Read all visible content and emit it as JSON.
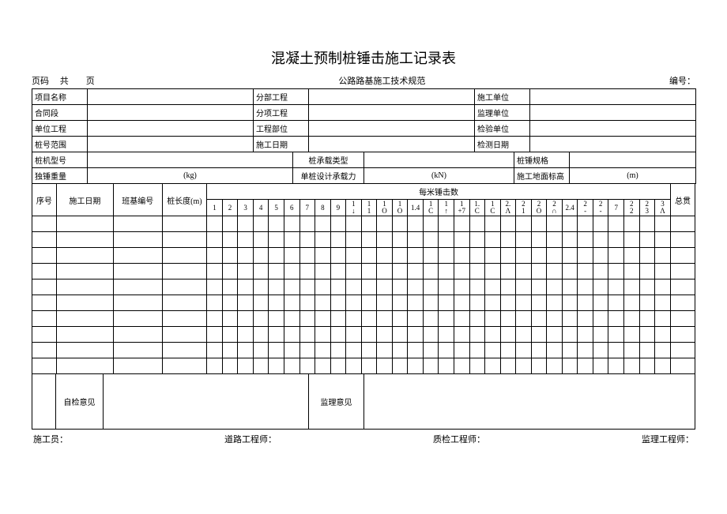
{
  "title": "混凝土预制桩锤击施工记录表",
  "top": {
    "page_label": "页码     共        页",
    "spec": "公路路基施工技术规范",
    "code_label": "编号："
  },
  "hdr": {
    "project_name": "项目名称",
    "sub_project": "分部工程",
    "construct_unit": "施工单位",
    "contract": "合同段",
    "item_project": "分项工程",
    "super_unit": "监理单位",
    "unit_project": "单位工程",
    "part": "工程部位",
    "inspect_unit": "检验单位",
    "pile_range": "桩号范围",
    "construct_date": "施工日期",
    "test_date": "检测日期",
    "pile_machine": "桩机型号",
    "pile_type": "桩承载类型",
    "pile_spec": "桩锤规格",
    "hammer_weight": "独锤重量",
    "hammer_unit": "(kg)",
    "design_cap": "单桩设计承载力",
    "cap_unit": "(kN)",
    "ground_elev": "施工地面标高",
    "elev_unit": "(m)"
  },
  "cols": {
    "seq": "序号",
    "date": "施工日期",
    "shift": "班基编号",
    "len": "桩长度(m)",
    "per_meter": "每米锤击数",
    "total": "总贯",
    "nums": [
      "1",
      "2",
      "3",
      "4",
      "5",
      "6",
      "7",
      "8",
      "9",
      "1\n↓",
      "1\n1",
      "1\nO",
      "1\nO",
      "1.4",
      "1\nC",
      "1\n↑",
      "1\n+7",
      "1.\nC",
      "1\nC",
      "2.\nΛ",
      "2\n1",
      "2\nO",
      "2\n∩",
      "2.4",
      "2\n-",
      "2\n-",
      "7",
      "2\n2",
      "2\n3",
      "3\nΛ"
    ]
  },
  "opinion": {
    "self": "自检意见",
    "super": "监理意见"
  },
  "footer": {
    "constructor": "施工员：",
    "road_eng": "道路工程师：",
    "qc_eng": "质检工程师：",
    "super_eng": "监理工程师："
  }
}
